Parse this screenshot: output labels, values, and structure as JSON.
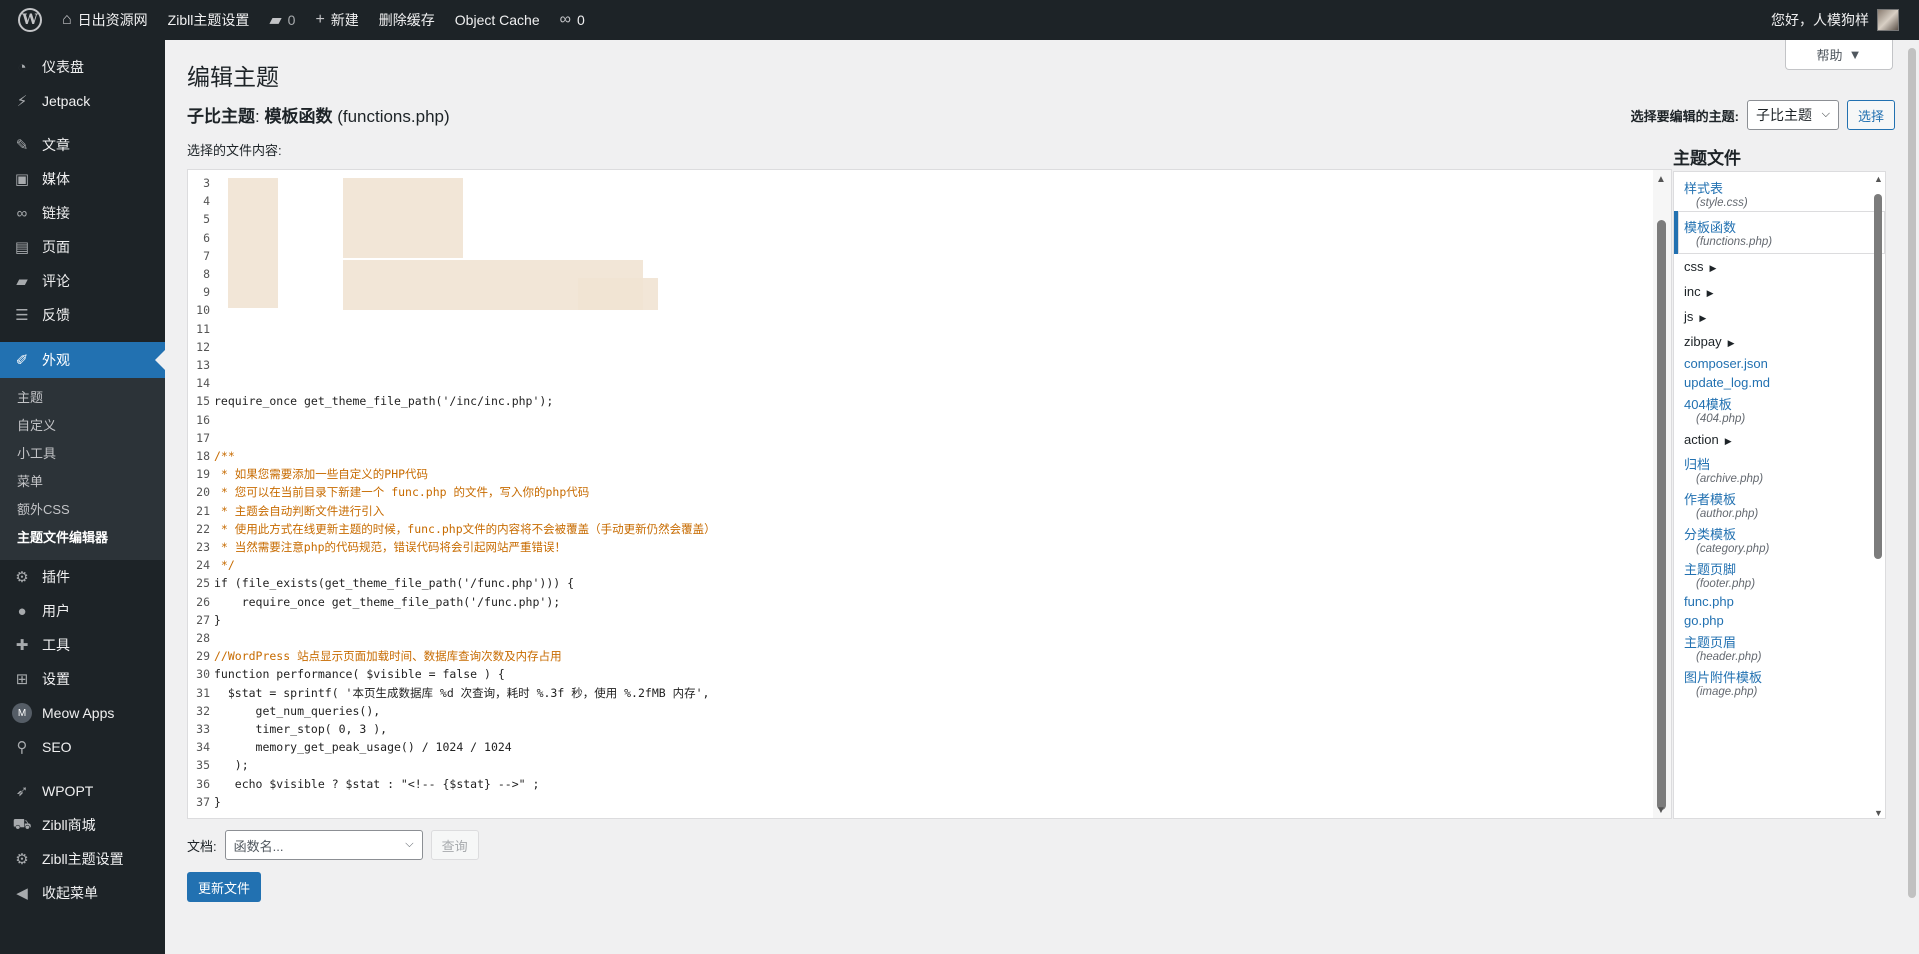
{
  "adminbar": {
    "site_name": "日出资源网",
    "theme_settings": "Zibll主题设置",
    "comments_count": "0",
    "new_label": "新建",
    "clear_cache": "删除缓存",
    "object_cache": "Object Cache",
    "links_count": "0",
    "greeting": "您好，人模狗样"
  },
  "sidebar": {
    "items": [
      {
        "label": "仪表盘",
        "icon": "dashboard-icon"
      },
      {
        "label": "Jetpack",
        "icon": "jetpack-icon"
      },
      {
        "label": "文章",
        "icon": "pin-icon"
      },
      {
        "label": "媒体",
        "icon": "media-icon"
      },
      {
        "label": "链接",
        "icon": "link-icon"
      },
      {
        "label": "页面",
        "icon": "page-icon"
      },
      {
        "label": "评论",
        "icon": "comment-icon"
      },
      {
        "label": "反馈",
        "icon": "feedback-icon"
      },
      {
        "label": "外观",
        "icon": "appearance-icon"
      },
      {
        "label": "插件",
        "icon": "plugin-icon"
      },
      {
        "label": "用户",
        "icon": "user-icon"
      },
      {
        "label": "工具",
        "icon": "wrench-icon"
      },
      {
        "label": "设置",
        "icon": "settings-icon"
      },
      {
        "label": "Meow Apps",
        "icon": "meow-icon"
      },
      {
        "label": "SEO",
        "icon": "search-icon"
      },
      {
        "label": "WPOPT",
        "icon": "rocket-icon"
      },
      {
        "label": "Zibll商城",
        "icon": "cart-icon"
      },
      {
        "label": "Zibll主题设置",
        "icon": "gear-icon"
      },
      {
        "label": "收起菜单",
        "icon": "collapse-icon"
      }
    ],
    "submenu": [
      "主题",
      "自定义",
      "小工具",
      "菜单",
      "额外CSS",
      "主题文件编辑器"
    ]
  },
  "main": {
    "help": "帮助",
    "title": "编辑主题",
    "file_title_theme": "子比主题",
    "file_title_file": "模板函数",
    "file_title_name": "(functions.php)",
    "select_theme_label": "选择要编辑的主题:",
    "selected_theme": "子比主题",
    "select_button": "选择",
    "content_label": "选择的文件内容:",
    "doc_label": "文档:",
    "doc_placeholder": "函数名...",
    "lookup_button": "查询",
    "update_button": "更新文件"
  },
  "code": [
    {
      "n": "3",
      "t": ""
    },
    {
      "n": "4",
      "t": ""
    },
    {
      "n": "5",
      "t": ""
    },
    {
      "n": "6",
      "t": ""
    },
    {
      "n": "7",
      "t": ""
    },
    {
      "n": "8",
      "t": ""
    },
    {
      "n": "9",
      "t": ""
    },
    {
      "n": "10",
      "t": ""
    },
    {
      "n": "11",
      "t": ""
    },
    {
      "n": "12",
      "t": ""
    },
    {
      "n": "13",
      "t": ""
    },
    {
      "n": "14",
      "t": ""
    },
    {
      "n": "15",
      "t": "require_once get_theme_file_path('/inc/inc.php');"
    },
    {
      "n": "16",
      "t": ""
    },
    {
      "n": "17",
      "t": ""
    },
    {
      "n": "18",
      "t": "/**",
      "cls": "c-comment"
    },
    {
      "n": "19",
      "t": " * 如果您需要添加一些自定义的PHP代码",
      "cls": "c-comment"
    },
    {
      "n": "20",
      "t": " * 您可以在当前目录下新建一个 func.php 的文件，写入你的php代码",
      "cls": "c-comment"
    },
    {
      "n": "21",
      "t": " * 主题会自动判断文件进行引入",
      "cls": "c-comment"
    },
    {
      "n": "22",
      "t": " * 使用此方式在线更新主题的时候，func.php文件的内容将不会被覆盖（手动更新仍然会覆盖）",
      "cls": "c-comment"
    },
    {
      "n": "23",
      "t": " * 当然需要注意php的代码规范，错误代码将会引起网站严重错误！",
      "cls": "c-comment"
    },
    {
      "n": "24",
      "t": " */",
      "cls": "c-comment"
    },
    {
      "n": "25",
      "t": "if (file_exists(get_theme_file_path('/func.php'))) {"
    },
    {
      "n": "26",
      "t": "    require_once get_theme_file_path('/func.php');"
    },
    {
      "n": "27",
      "t": "}"
    },
    {
      "n": "28",
      "t": ""
    },
    {
      "n": "29",
      "t": "//WordPress 站点显示页面加载时间、数据库查询次数及内存占用",
      "cls": "c-comment"
    },
    {
      "n": "30",
      "t": "function performance( $visible = false ) {"
    },
    {
      "n": "31",
      "t": "  $stat = sprintf( '本页生成数据库 %d 次查询，耗时 %.3f 秒，使用 %.2fMB 内存',"
    },
    {
      "n": "32",
      "t": "      get_num_queries(),"
    },
    {
      "n": "33",
      "t": "      timer_stop( 0, 3 ),"
    },
    {
      "n": "34",
      "t": "      memory_get_peak_usage() / 1024 / 1024"
    },
    {
      "n": "35",
      "t": "   );"
    },
    {
      "n": "36",
      "t": "   echo $visible ? $stat : \"<!-- {$stat} -->\" ;"
    },
    {
      "n": "37",
      "t": "}"
    }
  ],
  "files": {
    "title": "主题文件",
    "entries": [
      {
        "kind": "file",
        "label": "样式表",
        "fname": "(style.css)"
      },
      {
        "kind": "file",
        "label": "模板函数",
        "fname": "(functions.php)",
        "active": true
      },
      {
        "kind": "folder",
        "label": "css"
      },
      {
        "kind": "folder",
        "label": "inc"
      },
      {
        "kind": "folder",
        "label": "js"
      },
      {
        "kind": "folder",
        "label": "zibpay"
      },
      {
        "kind": "file",
        "label": "composer.json"
      },
      {
        "kind": "file",
        "label": "update_log.md"
      },
      {
        "kind": "file",
        "label": "404模板",
        "fname": "(404.php)"
      },
      {
        "kind": "folder",
        "label": "action"
      },
      {
        "kind": "file",
        "label": "归档",
        "fname": "(archive.php)"
      },
      {
        "kind": "file",
        "label": "作者模板",
        "fname": "(author.php)"
      },
      {
        "kind": "file",
        "label": "分类模板",
        "fname": "(category.php)"
      },
      {
        "kind": "file",
        "label": "主题页脚",
        "fname": "(footer.php)"
      },
      {
        "kind": "file",
        "label": "func.php"
      },
      {
        "kind": "file",
        "label": "go.php"
      },
      {
        "kind": "file",
        "label": "主题页眉",
        "fname": "(header.php)"
      },
      {
        "kind": "file",
        "label": "图片附件模板",
        "fname": "(image.php)"
      }
    ]
  }
}
